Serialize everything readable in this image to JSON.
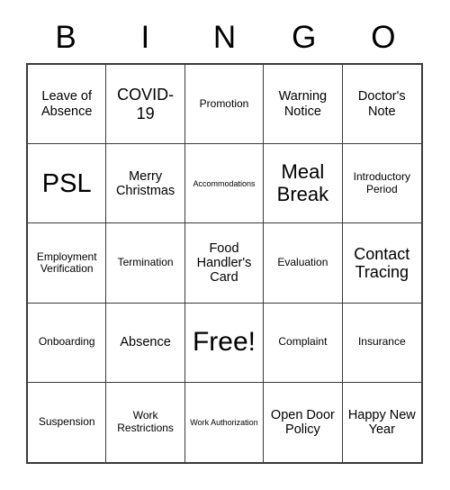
{
  "card": {
    "title": "BINGO",
    "header_letters": [
      "B",
      "I",
      "N",
      "G",
      "O"
    ],
    "border_color": "#3a3a3a",
    "text_color": "#000000",
    "background_color": "#ffffff",
    "rows": [
      [
        {
          "label": "Leave of Absence",
          "size": "md"
        },
        {
          "label": "COVID-19",
          "size": "lg"
        },
        {
          "label": "Promotion",
          "size": "sm"
        },
        {
          "label": "Warning Notice",
          "size": "md"
        },
        {
          "label": "Doctor's Note",
          "size": "md"
        }
      ],
      [
        {
          "label": "PSL",
          "size": "xxl"
        },
        {
          "label": "Merry Christmas",
          "size": "md"
        },
        {
          "label": "Accommodations",
          "size": "xs"
        },
        {
          "label": "Meal Break",
          "size": "xl"
        },
        {
          "label": "Introductory Period",
          "size": "sm"
        }
      ],
      [
        {
          "label": "Employment Verification",
          "size": "sm"
        },
        {
          "label": "Termination",
          "size": "sm"
        },
        {
          "label": "Food Handler's Card",
          "size": "md"
        },
        {
          "label": "Evaluation",
          "size": "sm"
        },
        {
          "label": "Contact Tracing",
          "size": "lg"
        }
      ],
      [
        {
          "label": "Onboarding",
          "size": "sm"
        },
        {
          "label": "Absence",
          "size": "md"
        },
        {
          "label": "Free!",
          "size": "free"
        },
        {
          "label": "Complaint",
          "size": "sm"
        },
        {
          "label": "Insurance",
          "size": "sm"
        }
      ],
      [
        {
          "label": "Suspension",
          "size": "sm"
        },
        {
          "label": "Work Restrictions",
          "size": "sm"
        },
        {
          "label": "Work Authorization",
          "size": "xs"
        },
        {
          "label": "Open Door Policy",
          "size": "md"
        },
        {
          "label": "Happy New Year",
          "size": "md"
        }
      ]
    ]
  }
}
